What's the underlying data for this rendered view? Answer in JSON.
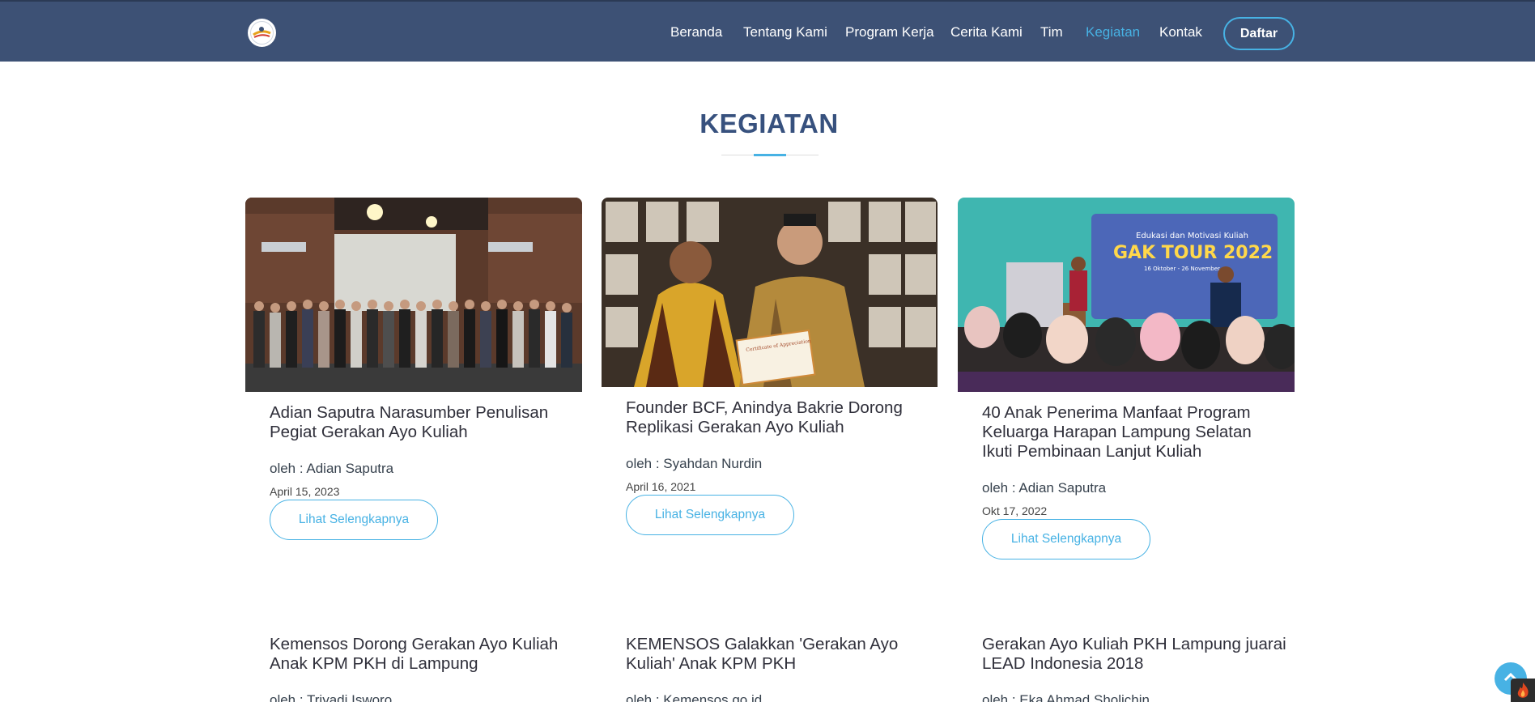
{
  "header": {
    "nav": [
      "Beranda",
      "Tentang Kami",
      "Program Kerja",
      "Cerita Kami",
      "Tim",
      "Kegiatan",
      "Kontak"
    ],
    "active": "Kegiatan",
    "cta": "Daftar"
  },
  "section": {
    "title": "KEGIATAN"
  },
  "cards": [
    {
      "title": "Adian Saputra Narasumber Penulisan Pegiat Gerakan Ayo Kuliah",
      "author": "oleh : Adian Saputra",
      "date": "April 15, 2023",
      "button": "Lihat Selengkapnya"
    },
    {
      "title": "Founder BCF, Anindya Bakrie Dorong Replikasi Gerakan Ayo Kuliah",
      "author": "oleh : Syahdan Nurdin",
      "date": "April 16, 2021",
      "button": "Lihat Selengkapnya"
    },
    {
      "title": "40 Anak Penerima Manfaat Program Keluarga Harapan Lampung Selatan Ikuti Pembinaan Lanjut Kuliah",
      "author": "oleh : Adian Saputra",
      "date": "Okt 17, 2022",
      "button": "Lihat Selengkapnya"
    },
    {
      "title": "Kemensos Dorong Gerakan Ayo Kuliah Anak KPM PKH di Lampung",
      "author": "oleh : Triyadi Isworo"
    },
    {
      "title": "KEMENSOS Galakkan 'Gerakan Ayo Kuliah' Anak KPM PKH",
      "author": "oleh : Kemensos.go.id"
    },
    {
      "title": "Gerakan Ayo Kuliah PKH Lampung juarai LEAD Indonesia 2018",
      "author": "oleh : Eka Ahmad Sholichin"
    }
  ],
  "photo3": {
    "poster_small": "Edukasi dan Motivasi Kuliah",
    "poster_big": "GAK TOUR 2022",
    "poster_dates": "16 Oktober - 26 November"
  },
  "photo2": {
    "certificate": "Certificate of Appreciation"
  },
  "colors": {
    "header_bg": "#3d5175",
    "accent": "#47b2e4",
    "title": "#37517e"
  }
}
